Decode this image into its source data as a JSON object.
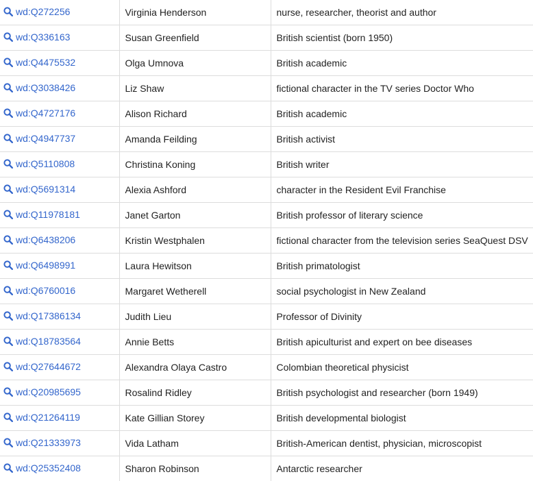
{
  "results": {
    "icon": "search-icon",
    "link_color": "#3366cc",
    "rows": [
      {
        "id": "wd:Q272256",
        "label": "Virginia Henderson",
        "description": "nurse, researcher, theorist and author"
      },
      {
        "id": "wd:Q336163",
        "label": "Susan Greenfield",
        "description": "British scientist (born 1950)"
      },
      {
        "id": "wd:Q4475532",
        "label": "Olga Umnova",
        "description": "British academic"
      },
      {
        "id": "wd:Q3038426",
        "label": "Liz Shaw",
        "description": "fictional character in the TV series Doctor Who"
      },
      {
        "id": "wd:Q4727176",
        "label": "Alison Richard",
        "description": "British academic"
      },
      {
        "id": "wd:Q4947737",
        "label": "Amanda Feilding",
        "description": "British activist"
      },
      {
        "id": "wd:Q5110808",
        "label": "Christina Koning",
        "description": "British writer"
      },
      {
        "id": "wd:Q5691314",
        "label": "Alexia Ashford",
        "description": "character in the Resident Evil Franchise"
      },
      {
        "id": "wd:Q11978181",
        "label": "Janet Garton",
        "description": "British professor of literary science"
      },
      {
        "id": "wd:Q6438206",
        "label": "Kristin Westphalen",
        "description": "fictional character from the television series SeaQuest DSV"
      },
      {
        "id": "wd:Q6498991",
        "label": "Laura Hewitson",
        "description": "British primatologist"
      },
      {
        "id": "wd:Q6760016",
        "label": "Margaret Wetherell",
        "description": "social psychologist in New Zealand"
      },
      {
        "id": "wd:Q17386134",
        "label": "Judith Lieu",
        "description": "Professor of Divinity"
      },
      {
        "id": "wd:Q18783564",
        "label": "Annie Betts",
        "description": "British apiculturist and expert on bee diseases"
      },
      {
        "id": "wd:Q27644672",
        "label": "Alexandra Olaya Castro",
        "description": "Colombian theoretical physicist"
      },
      {
        "id": "wd:Q20985695",
        "label": "Rosalind Ridley",
        "description": "British psychologist and researcher (born 1949)"
      },
      {
        "id": "wd:Q21264119",
        "label": "Kate Gillian Storey",
        "description": "British developmental biologist"
      },
      {
        "id": "wd:Q21333973",
        "label": "Vida Latham",
        "description": "British-American dentist, physician, microscopist"
      },
      {
        "id": "wd:Q25352408",
        "label": "Sharon Robinson",
        "description": "Antarctic researcher"
      }
    ]
  }
}
